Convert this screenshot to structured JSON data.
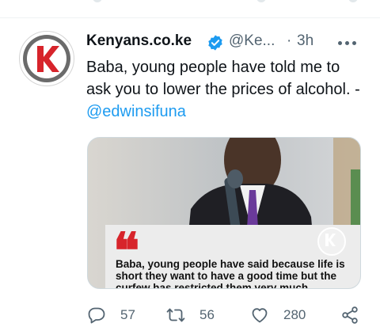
{
  "tweet": {
    "display_name": "Kenyans.co.ke",
    "handle": "@Ke...",
    "separator": "·",
    "time": "3h",
    "text_main": "Baba, young people have told me to ask you to lower the prices of alcohol. - ",
    "mention": "@edwinsifuna",
    "media": {
      "quote_mark": "❝",
      "caption": "Baba, young people have said because life is short they want to have a good time but the curfew has restricted them very much",
      "accent_color": "#d7242b"
    },
    "actions": {
      "replies": "57",
      "retweets": "56",
      "likes": "280"
    }
  },
  "icons": {
    "avatar": "kenyans-logo-icon",
    "verified": "verified-badge-icon",
    "more": "more-dots-icon",
    "reply": "reply-icon",
    "retweet": "retweet-icon",
    "like": "heart-icon",
    "share": "share-icon"
  },
  "colors": {
    "link": "#1d9bf0",
    "secondary_text": "#536471",
    "brand_red": "#d7242b"
  }
}
